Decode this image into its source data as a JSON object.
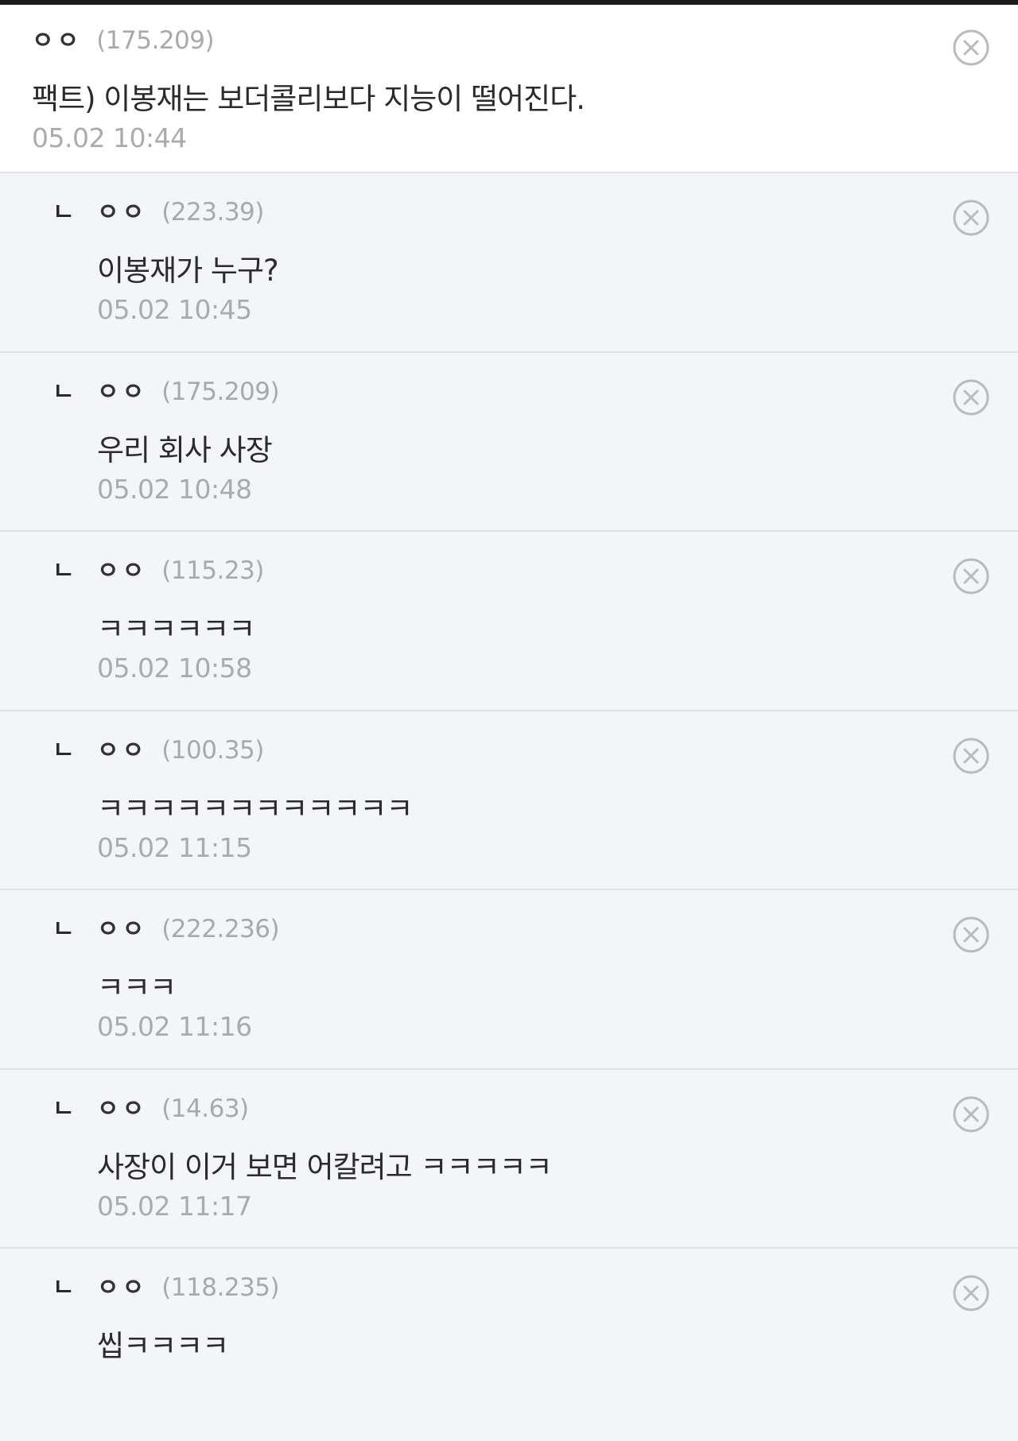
{
  "comments": [
    {
      "author": "ㅇㅇ",
      "ip": "(175.209)",
      "text": "팩트) 이봉재는 보더콜리보다 지능이 떨어진다.",
      "time": "05.02 10:44"
    }
  ],
  "replies": [
    {
      "mark": "ㄴ",
      "author": "ㅇㅇ",
      "ip": "(223.39)",
      "text": "이봉재가 누구?",
      "time": "05.02 10:45"
    },
    {
      "mark": "ㄴ",
      "author": "ㅇㅇ",
      "ip": "(175.209)",
      "text": "우리 회사 사장",
      "time": "05.02 10:48"
    },
    {
      "mark": "ㄴ",
      "author": "ㅇㅇ",
      "ip": "(115.23)",
      "text": "ㅋㅋㅋㅋㅋㅋ",
      "time": "05.02 10:58"
    },
    {
      "mark": "ㄴ",
      "author": "ㅇㅇ",
      "ip": "(100.35)",
      "text": "ㅋㅋㅋㅋㅋㅋㅋㅋㅋㅋㅋㅋ",
      "time": "05.02 11:15"
    },
    {
      "mark": "ㄴ",
      "author": "ㅇㅇ",
      "ip": "(222.236)",
      "text": "ㅋㅋㅋ",
      "time": "05.02 11:16"
    },
    {
      "mark": "ㄴ",
      "author": "ㅇㅇ",
      "ip": "(14.63)",
      "text": "사장이 이거 보면 어칼려고 ㅋㅋㅋㅋㅋ",
      "time": "05.02 11:17"
    },
    {
      "mark": "ㄴ",
      "author": "ㅇㅇ",
      "ip": "(118.235)",
      "text": "씹ㅋㅋㅋㅋ",
      "time": ""
    }
  ],
  "icons": {
    "delete": "close-circle-icon"
  },
  "colors": {
    "background": "#f4f5f8",
    "main_background": "#ffffff",
    "ip": "#a7a9ad",
    "time": "#a9abb0",
    "text": "#2b2b2b",
    "delete_icon": "#b9bbc0"
  }
}
